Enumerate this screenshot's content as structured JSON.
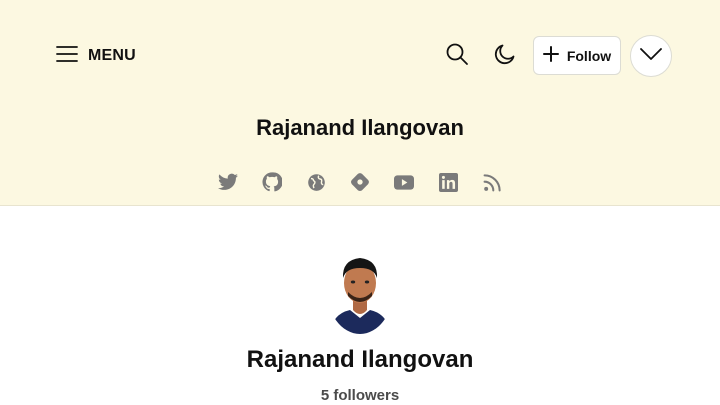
{
  "header": {
    "menu_label": "MENU",
    "follow_label": "Follow",
    "blog_title": "Rajanand Ilangovan",
    "background": "#fcf8e1"
  },
  "social_icons": [
    "twitter-icon",
    "github-icon",
    "globe-icon",
    "hashnode-icon",
    "youtube-icon",
    "linkedin-icon",
    "rss-icon"
  ],
  "profile": {
    "name": "Rajanand Ilangovan",
    "followers": "5 followers"
  }
}
